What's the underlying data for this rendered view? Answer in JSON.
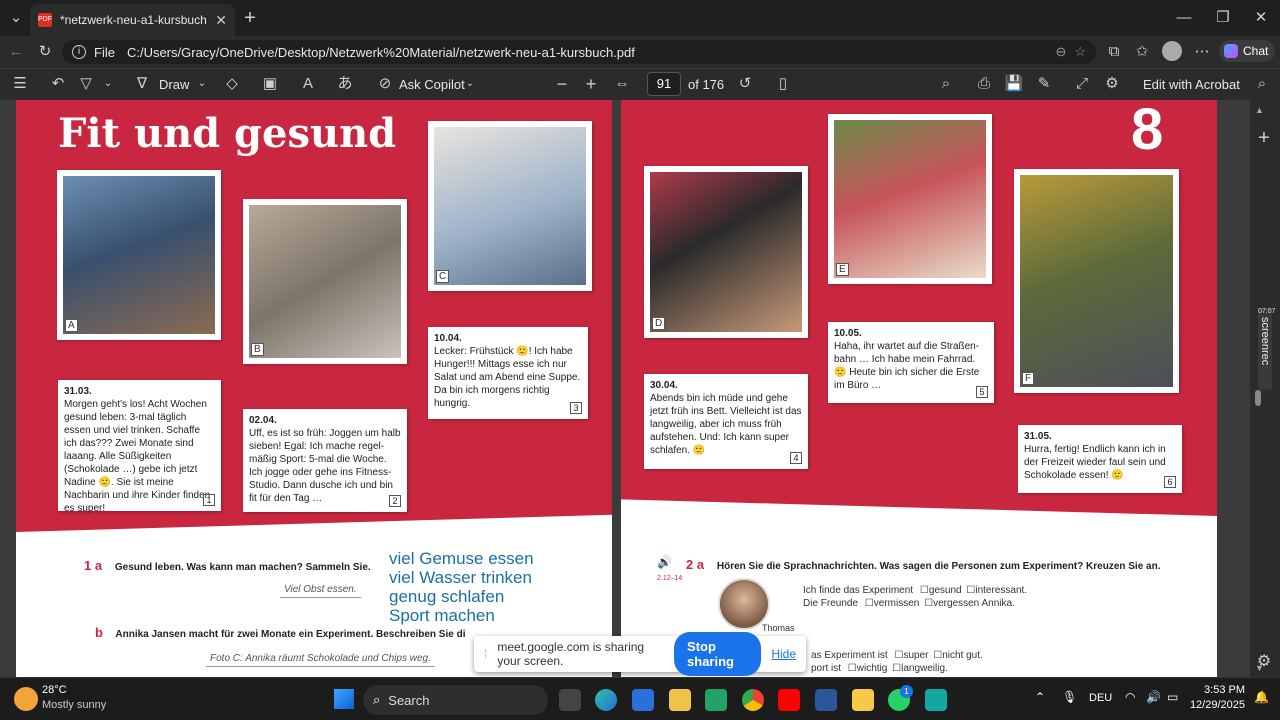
{
  "browser": {
    "tab_title": "*netzwerk-neu-a1-kursbuch.pdf",
    "file_label": "File",
    "url": "C:/Users/Gracy/OneDrive/Desktop/Netzwerk%20Material/netzwerk-neu-a1-kursbuch.pdf",
    "chat_label": "Chat"
  },
  "pdf_toolbar": {
    "draw_label": "Draw",
    "copilot_label": "Ask Copilot",
    "page_number": "91",
    "page_total": "of 176",
    "edit_label": "Edit with Acrobat"
  },
  "page_left": {
    "title": "Fit und gesund",
    "photo_labels": [
      "A",
      "B",
      "C"
    ],
    "notes": [
      {
        "date": "31.03.",
        "text": "Morgen geht's los! Acht Wochen gesund leben: 3-mal täglich essen und viel trinken. Schaffe ich das??? Zwei Monate sind laaang. Alle Süßigkeiten (Schokolade …) gebe ich jetzt Nadine 🙂. Sie ist meine Nachbarin und ihre Kinder finden es super!",
        "num": "1"
      },
      {
        "date": "02.04.",
        "text": "Uff, es ist so früh: Joggen um halb sieben! Egal: Ich mache regel-mäßig Sport: 5-mal die Woche. Ich jogge oder gehe ins Fitness-Studio. Dann dusche ich und bin fit für den Tag …",
        "num": "2"
      },
      {
        "date": "10.04.",
        "text": "Lecker: Frühstück 🙂! Ich habe Hunger!!! Mittags esse ich nur Salat und am Abend eine Suppe. Da bin ich morgens richtig hungrig.",
        "num": "3"
      }
    ],
    "ex1a_num": "1 a",
    "ex1a_text": "Gesund leben. Was kann man machen? Sammeln Sie.",
    "ex1a_example": "Viel Obst essen.",
    "phrases": [
      "viel Gemuse essen",
      "viel Wasser trinken",
      "genug schlafen",
      "Sport machen"
    ],
    "ex1b_num": "b",
    "ex1b_text": "Annika Jansen macht für zwei Monate ein Experiment. Beschreiben Sie die Bilder.",
    "ex1b_example": "Foto C: Annika räumt Schokolade und Chips weg."
  },
  "page_right": {
    "chapter": "8",
    "photo_labels": [
      "D",
      "E",
      "F"
    ],
    "notes": [
      {
        "date": "30.04.",
        "text": "Abends bin ich müde und gehe jetzt früh ins Bett. Vielleicht ist das langweilig, aber ich muss früh aufstehen. Und: Ich kann super schlafen. 🙂",
        "num": "4"
      },
      {
        "date": "10.05.",
        "text": "Haha, ihr wartet auf die Straßen-bahn … Ich habe mein Fahrrad. 🙂 Heute bin ich sicher die Erste im Büro …",
        "num": "5"
      },
      {
        "date": "31.05.",
        "text": "Hurra, fertig! Endlich kann ich in der Freizeit wieder faul sein und Schokolade essen! 🙂",
        "num": "6"
      }
    ],
    "ex2a_num": "2 a",
    "ex2a_track": "2.12–14",
    "ex2a_text": "Hören Sie die Sprachnachrichten. Was sagen die Personen zum Experiment? Kreuzen Sie an.",
    "speaker": "Thomas",
    "line1": "Ich finde das Experiment",
    "line1_opts": [
      "gesund",
      "interessant."
    ],
    "line2": "Die Freunde",
    "line2_opts": [
      "vermissen",
      "vergessen Annika."
    ],
    "line3": "as Experiment ist",
    "line3_opts": [
      "super",
      "nicht gut."
    ],
    "line4": "port ist",
    "line4_opts": [
      "wichtig",
      "langweilig."
    ]
  },
  "share_bar": {
    "text": "meet.google.com is sharing your screen.",
    "stop_label": "Stop sharing",
    "hide_label": "Hide"
  },
  "taskbar": {
    "temp": "28°C",
    "weather": "Mostly sunny",
    "search_label": "Search",
    "lang": "DEU",
    "time": "3:53 PM",
    "date": "12/29/2025",
    "badge_count": "1"
  },
  "side_label": "screenrec",
  "side_time": "07:07"
}
